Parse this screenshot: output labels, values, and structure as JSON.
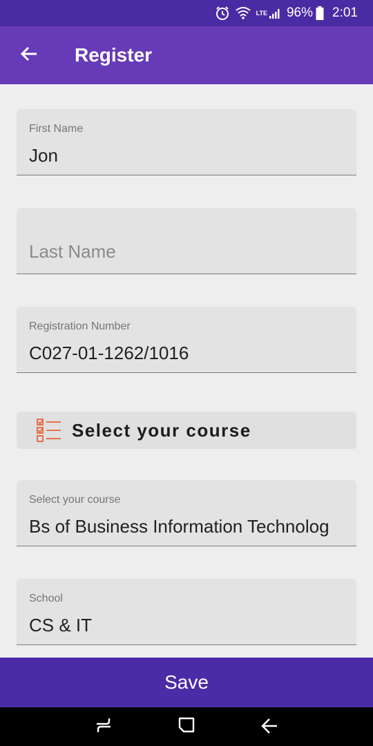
{
  "status_bar": {
    "network": "LTE",
    "battery": "96%",
    "time": "2:01"
  },
  "app_bar": {
    "title": "Register"
  },
  "form": {
    "first_name": {
      "label": "First Name",
      "value": "Jon"
    },
    "last_name": {
      "placeholder": "Last Name",
      "value": ""
    },
    "registration_number": {
      "label": "Registration Number",
      "value": "C027-01-1262/1016"
    },
    "course_button": {
      "label": "Select your course"
    },
    "course": {
      "label": "Select your course",
      "value": "Bs of Business Information Technolog"
    },
    "school": {
      "label": "School",
      "value": "CS & IT"
    }
  },
  "actions": {
    "save_label": "Save"
  },
  "colors": {
    "status_bar": "#4a2ba3",
    "app_bar": "#673ab7",
    "save_bar": "#4b2ba6",
    "course_icon": "#e8613a"
  },
  "icons": [
    "alarm-icon",
    "wifi-icon",
    "signal-icon",
    "battery-icon",
    "back-arrow-icon",
    "checklist-icon",
    "recents-icon",
    "home-icon",
    "back-nav-icon"
  ]
}
